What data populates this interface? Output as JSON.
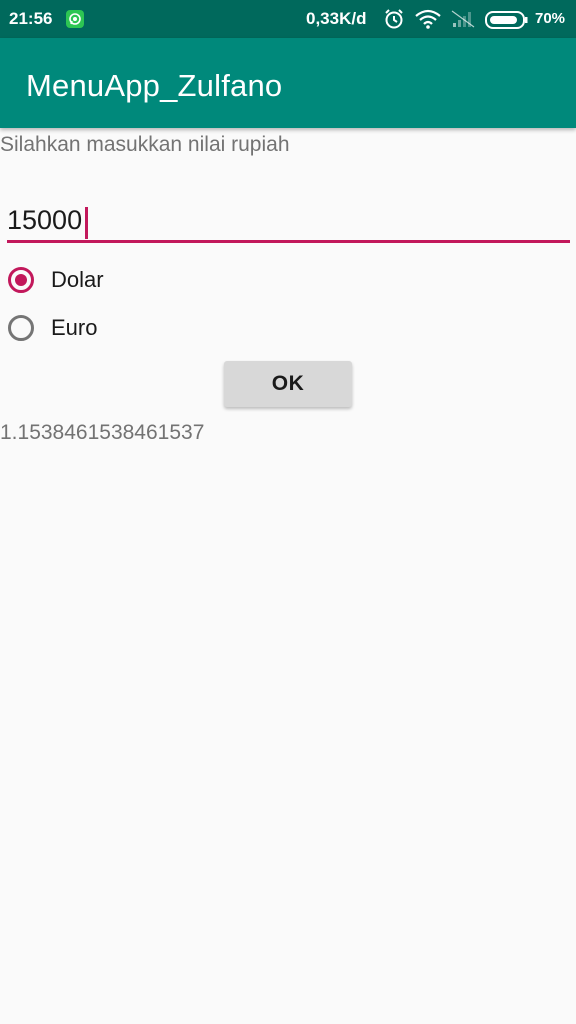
{
  "status_bar": {
    "time": "21:56",
    "network_speed": "0,33K/d",
    "battery": "70%",
    "icons": [
      "whatsapp-icon",
      "alarm-icon",
      "wifi-icon",
      "signal-icon",
      "battery-icon"
    ],
    "color": "#00695c"
  },
  "app_bar": {
    "title": "MenuApp_Zulfano",
    "color": "#00897b"
  },
  "form": {
    "prompt": "Silahkan masukkan nilai rupiah",
    "amount_value": "15000",
    "accent_color": "#c2185b",
    "options": [
      {
        "label": "Dolar",
        "checked": true
      },
      {
        "label": "Euro",
        "checked": false
      }
    ],
    "ok_label": "OK",
    "result": "1.1538461538461537"
  }
}
